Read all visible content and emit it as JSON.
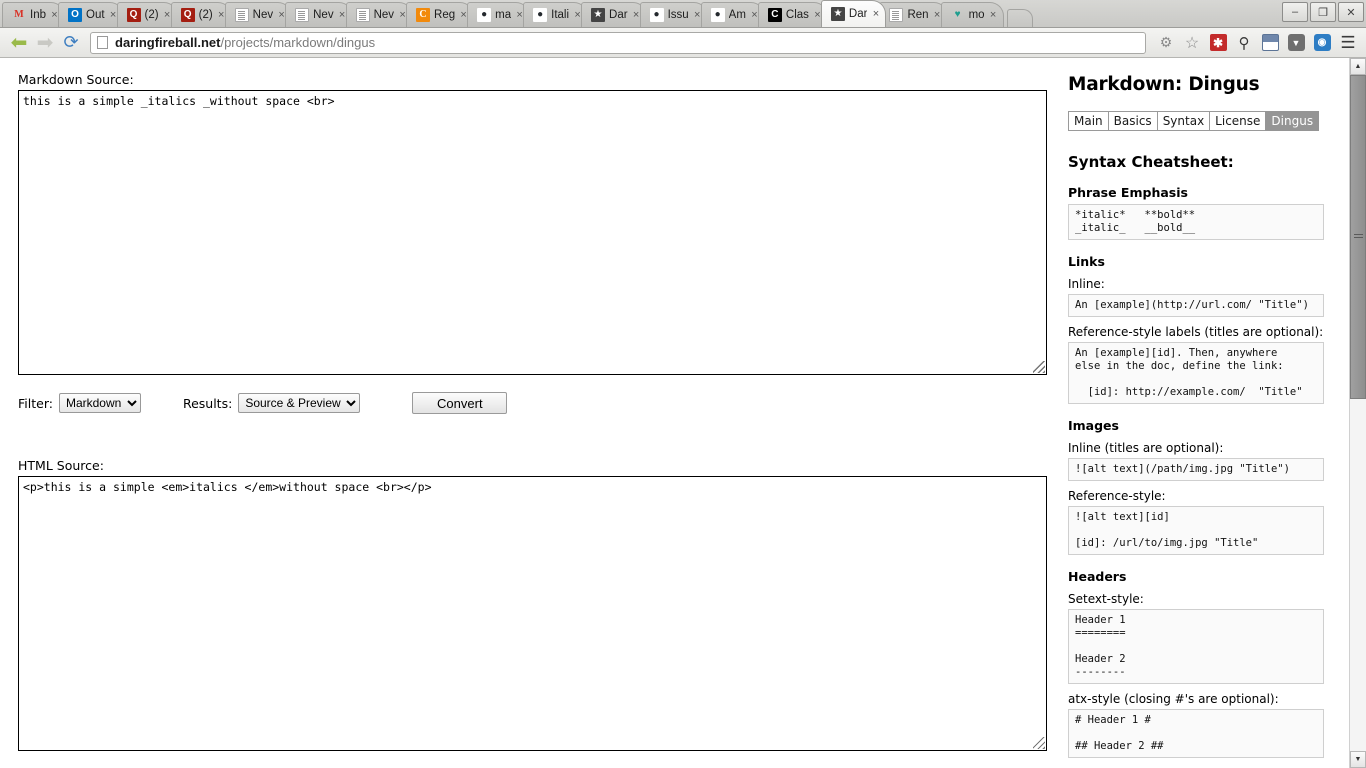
{
  "browser": {
    "tabs": [
      {
        "label": "Inb",
        "icon": "gmail-icon",
        "icon_glyph": "M",
        "icon_class": "fav-gmail",
        "active": false
      },
      {
        "label": "Out",
        "icon": "outlook-icon",
        "icon_glyph": "O",
        "icon_class": "fav-outlook",
        "active": false
      },
      {
        "label": "(2)",
        "icon": "quora-icon",
        "icon_glyph": "Q",
        "icon_class": "fav-q",
        "active": false
      },
      {
        "label": "(2)",
        "icon": "quora-icon",
        "icon_glyph": "Q",
        "icon_class": "fav-q",
        "active": false
      },
      {
        "label": "Nev",
        "icon": "document-icon",
        "icon_glyph": "",
        "icon_class": "fav-doc",
        "active": false
      },
      {
        "label": "Nev",
        "icon": "document-icon",
        "icon_glyph": "",
        "icon_class": "fav-doc",
        "active": false
      },
      {
        "label": "Nev",
        "icon": "document-icon",
        "icon_glyph": "",
        "icon_class": "fav-doc",
        "active": false
      },
      {
        "label": "Reg",
        "icon": "regex-icon",
        "icon_glyph": "C",
        "icon_class": "fav-reg",
        "active": false
      },
      {
        "label": "ma",
        "icon": "github-icon",
        "icon_glyph": "●",
        "icon_class": "fav-gh",
        "active": false
      },
      {
        "label": "Itali",
        "icon": "github-icon",
        "icon_glyph": "●",
        "icon_class": "fav-gh",
        "active": false
      },
      {
        "label": "Dar",
        "icon": "star-icon",
        "icon_glyph": "★",
        "icon_class": "fav-star",
        "active": false
      },
      {
        "label": "Issu",
        "icon": "github-icon",
        "icon_glyph": "●",
        "icon_class": "fav-gh",
        "active": false
      },
      {
        "label": "Am",
        "icon": "github-icon",
        "icon_glyph": "●",
        "icon_class": "fav-gh",
        "active": false
      },
      {
        "label": "Clas",
        "icon": "classroom-icon",
        "icon_glyph": "C",
        "icon_class": "fav-class",
        "active": false
      },
      {
        "label": "Dar",
        "icon": "star-icon",
        "icon_glyph": "★",
        "icon_class": "fav-star",
        "active": true
      },
      {
        "label": "Ren",
        "icon": "document-icon",
        "icon_glyph": "",
        "icon_class": "fav-doc",
        "active": false
      },
      {
        "label": "mo",
        "icon": "shield-icon",
        "icon_glyph": "♥",
        "icon_class": "fav-shield",
        "active": false
      }
    ],
    "tab_close_glyph": "×",
    "new_tab_name": "new-tab-button",
    "window_controls": [
      {
        "name": "minimize-button",
        "glyph": "–"
      },
      {
        "name": "restore-button",
        "glyph": "❐"
      },
      {
        "name": "close-button",
        "glyph": "✕"
      }
    ],
    "nav": {
      "back_glyph": "←",
      "forward_glyph": "→",
      "reload_glyph": "⟳",
      "url_host": "daringfireball.net",
      "url_path": "/projects/markdown/dingus",
      "url_full": "daringfireball.net/projects/markdown/dingus"
    },
    "toolbar_icons": [
      {
        "name": "bug-icon",
        "glyph": "⚙",
        "color": "#8a8a8a",
        "bg": "transparent"
      },
      {
        "name": "bookmark-star-icon",
        "glyph": "☆",
        "color": "#7a7a7a",
        "bg": "transparent"
      },
      {
        "name": "adblock-icon",
        "glyph": "✱",
        "color": "#ffffff",
        "bg": "#c32b2b"
      },
      {
        "name": "lamp-icon",
        "glyph": "⤵",
        "color": "#4a4a4a",
        "bg": "transparent"
      },
      {
        "name": "window-split-icon",
        "glyph": "◨",
        "color": "#4a6f9c",
        "bg": "transparent"
      },
      {
        "name": "pocket-icon",
        "glyph": "▼",
        "color": "#ffffff",
        "bg": "#6b6b6b"
      },
      {
        "name": "sync-icon",
        "glyph": "●",
        "color": "#ffffff",
        "bg": "#2d7dc4"
      },
      {
        "name": "menu-icon",
        "glyph": "≡",
        "color": "#4a4a4a",
        "bg": "transparent"
      }
    ]
  },
  "main": {
    "markdown_label": "Markdown Source:",
    "markdown_value": "this is a simple _italics _without space <br>",
    "markdown_placeholder": "",
    "html_label": "HTML Source:",
    "html_value": "<p>this is a simple <em>italics </em>without space <br></p>",
    "html_placeholder": "",
    "filter_label": "Filter:",
    "filter_value": "Markdown",
    "filter_options": [
      "Markdown"
    ],
    "results_label": "Results:",
    "results_value": "Source & Preview",
    "results_options": [
      "Source & Preview"
    ],
    "convert_label": "Convert"
  },
  "sidebar": {
    "title": "Markdown: Dingus",
    "nav_tabs": [
      {
        "label": "Main",
        "current": false
      },
      {
        "label": "Basics",
        "current": false
      },
      {
        "label": "Syntax",
        "current": false
      },
      {
        "label": "License",
        "current": false
      },
      {
        "label": "Dingus",
        "current": true
      }
    ],
    "cheatsheet_heading": "Syntax Cheatsheet:",
    "sections": [
      {
        "heading": "Phrase Emphasis",
        "blocks": [
          {
            "sub": "",
            "code": "*italic*   **bold**\n_italic_   __bold__"
          }
        ]
      },
      {
        "heading": "Links",
        "blocks": [
          {
            "sub": "Inline:",
            "code": "An [example](http://url.com/ \"Title\")"
          },
          {
            "sub": "Reference-style labels (titles are optional):",
            "code": "An [example][id]. Then, anywhere\nelse in the doc, define the link:\n\n  [id]: http://example.com/  \"Title\""
          }
        ]
      },
      {
        "heading": "Images",
        "blocks": [
          {
            "sub": "Inline (titles are optional):",
            "code": "![alt text](/path/img.jpg \"Title\")"
          },
          {
            "sub": "Reference-style:",
            "code": "![alt text][id]\n\n[id]: /url/to/img.jpg \"Title\""
          }
        ]
      },
      {
        "heading": "Headers",
        "blocks": [
          {
            "sub": "Setext-style:",
            "code": "Header 1\n========\n\nHeader 2\n--------"
          },
          {
            "sub": "atx-style (closing #'s are optional):",
            "code": "# Header 1 #\n\n## Header 2 ##"
          }
        ]
      }
    ]
  },
  "scrollbar": {
    "up_glyph": "▲",
    "down_glyph": "▼",
    "thumb_top_pct": 0,
    "thumb_height_pct": 48
  },
  "colors": {
    "chrome_bg": "#d7d7d4",
    "active_tab": "#fdfdfd",
    "page_bg": "#ffffff",
    "accent_selected_tab": "#959595",
    "code_bg": "#fafafa",
    "code_border": "#cfcfcf"
  }
}
